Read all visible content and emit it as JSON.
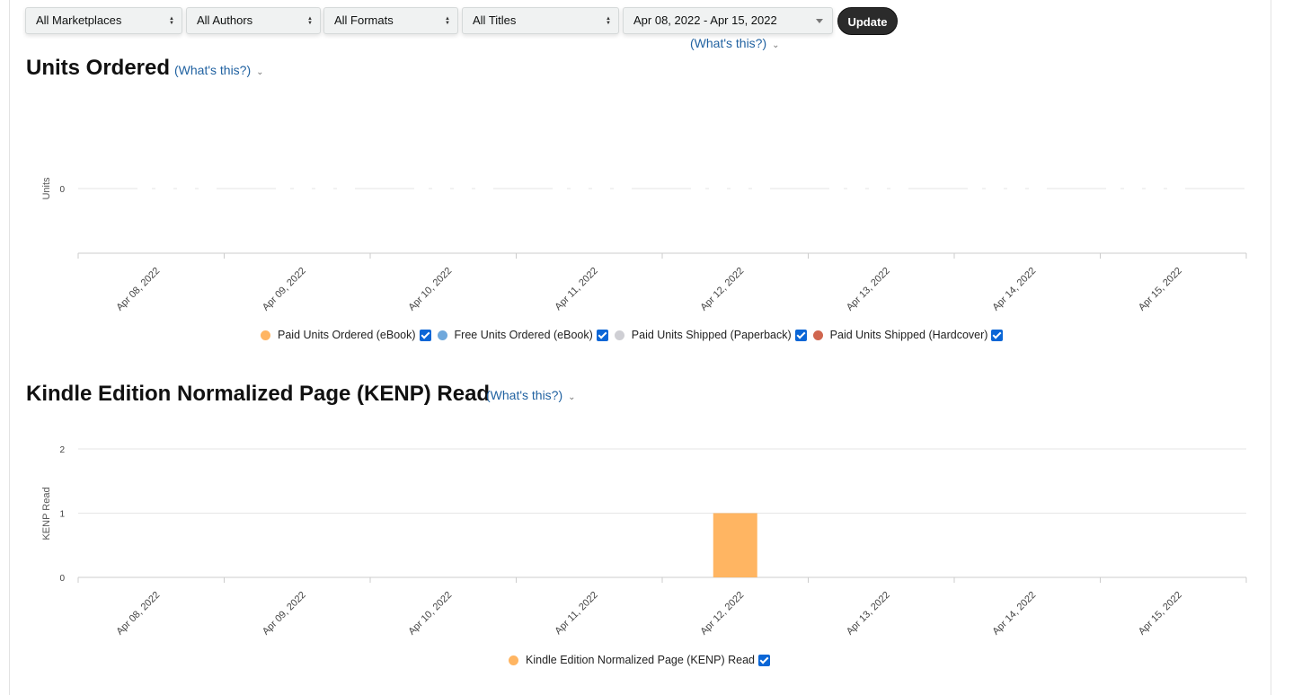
{
  "filters": {
    "marketplace": "All Marketplaces",
    "authors": "All Authors",
    "formats": "All Formats",
    "titles": "All Titles",
    "date_range": "Apr 08, 2022 - Apr 15, 2022",
    "update_label": "Update",
    "whats_this": "(What's this?)"
  },
  "units_section": {
    "title": "Units Ordered",
    "whats_this": "(What's this?)",
    "legend": [
      {
        "label": "Paid Units Ordered (eBook)",
        "color": "#ffb562",
        "checked": true
      },
      {
        "label": "Free Units Ordered (eBook)",
        "color": "#6fa8dc",
        "checked": true
      },
      {
        "label": "Paid Units Shipped (Paperback)",
        "color": "#cfcfd4",
        "checked": true
      },
      {
        "label": "Paid Units Shipped (Hardcover)",
        "color": "#d0664f",
        "checked": true
      }
    ]
  },
  "kenp_section": {
    "title": "Kindle Edition Normalized Page (KENP) Read",
    "whats_this": "(What's this?)",
    "legend": [
      {
        "label": "Kindle Edition Normalized Page (KENP) Read",
        "color": "#ffb562",
        "checked": true
      }
    ]
  },
  "chart_data": [
    {
      "type": "bar",
      "ylabel": "Units",
      "categories": [
        "Apr 08, 2022",
        "Apr 09, 2022",
        "Apr 10, 2022",
        "Apr 11, 2022",
        "Apr 12, 2022",
        "Apr 13, 2022",
        "Apr 14, 2022",
        "Apr 15, 2022"
      ],
      "yticks": [
        0
      ],
      "series": [
        {
          "name": "Paid Units Ordered (eBook)",
          "color": "#ffb562",
          "values": [
            0,
            0,
            0,
            0,
            0,
            0,
            0,
            0
          ]
        },
        {
          "name": "Free Units Ordered (eBook)",
          "color": "#6fa8dc",
          "values": [
            0,
            0,
            0,
            0,
            0,
            0,
            0,
            0
          ]
        },
        {
          "name": "Paid Units Shipped (Paperback)",
          "color": "#cfcfd4",
          "values": [
            0,
            0,
            0,
            0,
            0,
            0,
            0,
            0
          ]
        },
        {
          "name": "Paid Units Shipped (Hardcover)",
          "color": "#d0664f",
          "values": [
            0,
            0,
            0,
            0,
            0,
            0,
            0,
            0
          ]
        }
      ]
    },
    {
      "type": "bar",
      "ylabel": "KENP Read",
      "categories": [
        "Apr 08, 2022",
        "Apr 09, 2022",
        "Apr 10, 2022",
        "Apr 11, 2022",
        "Apr 12, 2022",
        "Apr 13, 2022",
        "Apr 14, 2022",
        "Apr 15, 2022"
      ],
      "yticks": [
        0,
        1,
        2
      ],
      "ylim": [
        0,
        2
      ],
      "series": [
        {
          "name": "Kindle Edition Normalized Page (KENP) Read",
          "color": "#ffb562",
          "values": [
            0,
            0,
            0,
            0,
            1,
            0,
            0,
            0
          ]
        }
      ]
    }
  ]
}
